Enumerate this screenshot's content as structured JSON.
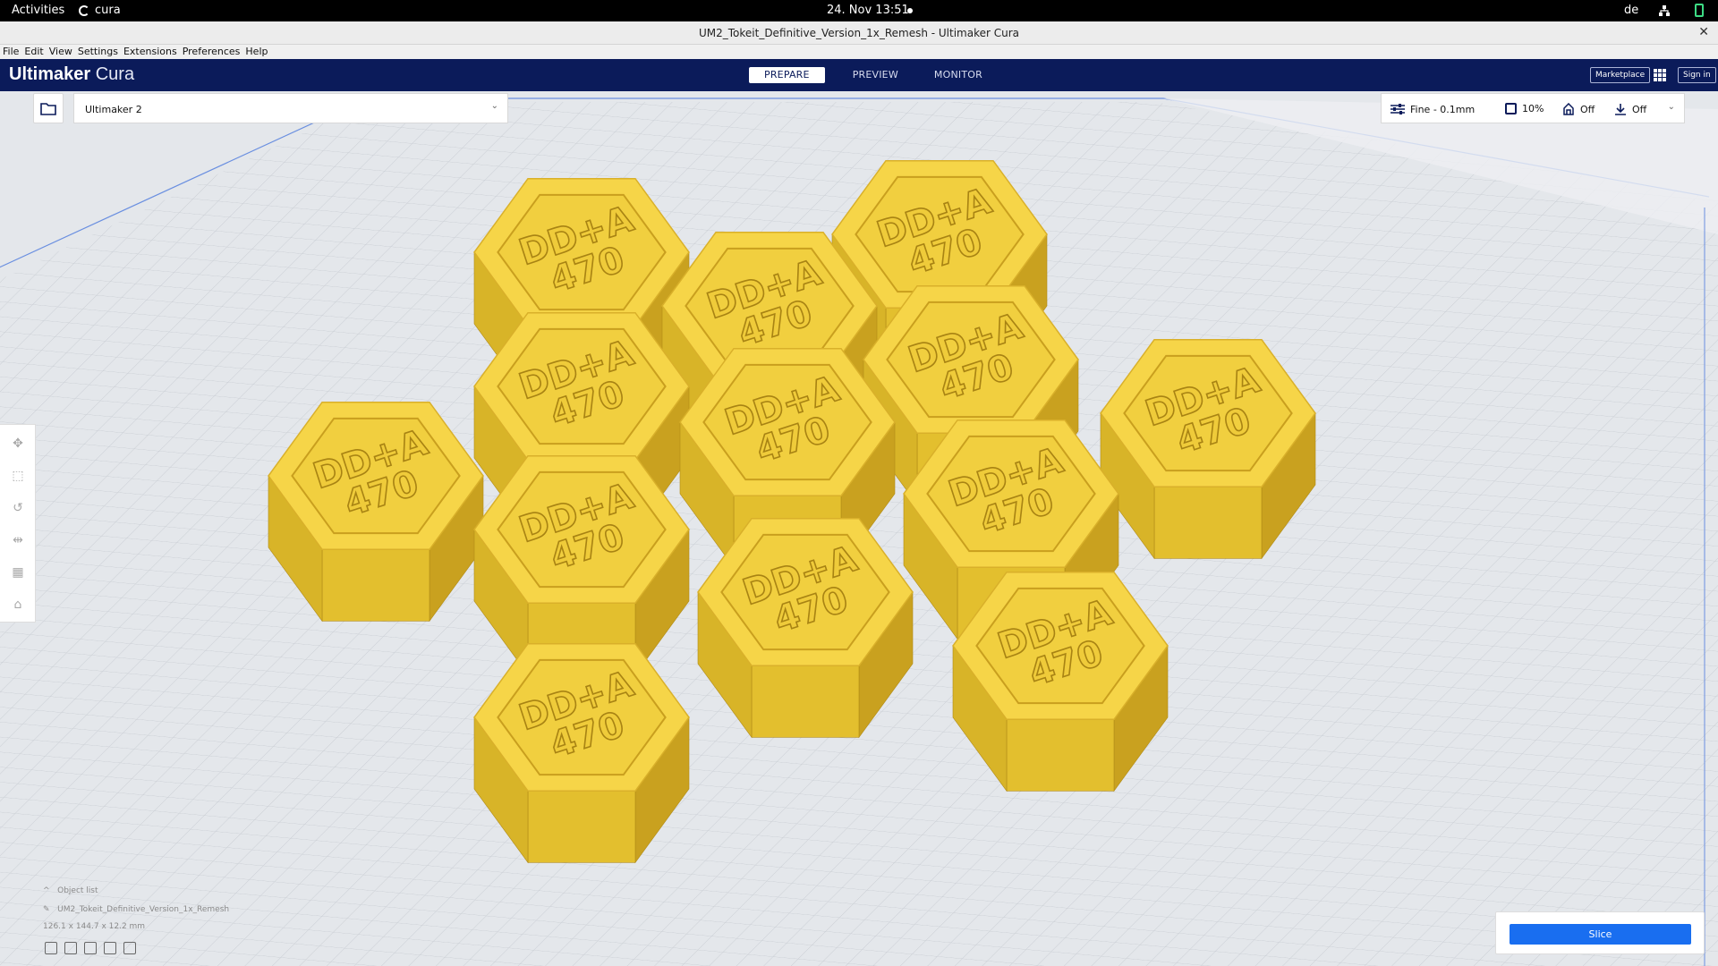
{
  "system_bar": {
    "activities": "Activities",
    "app_name": "cura",
    "clock": "24. Nov  13:51",
    "keyboard_layout": "de"
  },
  "window": {
    "title": "UM2_Tokeit_Definitive_Version_1x_Remesh - Ultimaker Cura",
    "close": "✕"
  },
  "menu": [
    "File",
    "Edit",
    "View",
    "Settings",
    "Extensions",
    "Preferences",
    "Help"
  ],
  "header": {
    "logo_bold": "Ultimaker",
    "logo_light": "Cura",
    "stages": [
      {
        "label": "PREPARE",
        "active": true
      },
      {
        "label": "PREVIEW",
        "active": false
      },
      {
        "label": "MONITOR",
        "active": false
      }
    ],
    "marketplace": "Marketplace",
    "sign_in": "Sign in"
  },
  "printer_select": {
    "name": "Ultimaker 2",
    "chevron": "⌄"
  },
  "print_settings": {
    "profile": "Fine - 0.1mm",
    "infill": "10%",
    "support": "Off",
    "adhesion": "Off"
  },
  "model": {
    "tile_text_line1": "DD+A",
    "tile_text_line2": "470",
    "color": "#f6d548"
  },
  "object_info": {
    "header": "Object list",
    "filename": "UM2_Tokeit_Definitive_Version_1x_Remesh",
    "dimensions": "126.1 x 144.7 x 12.2 mm"
  },
  "slice": {
    "button_label": "Slice"
  }
}
